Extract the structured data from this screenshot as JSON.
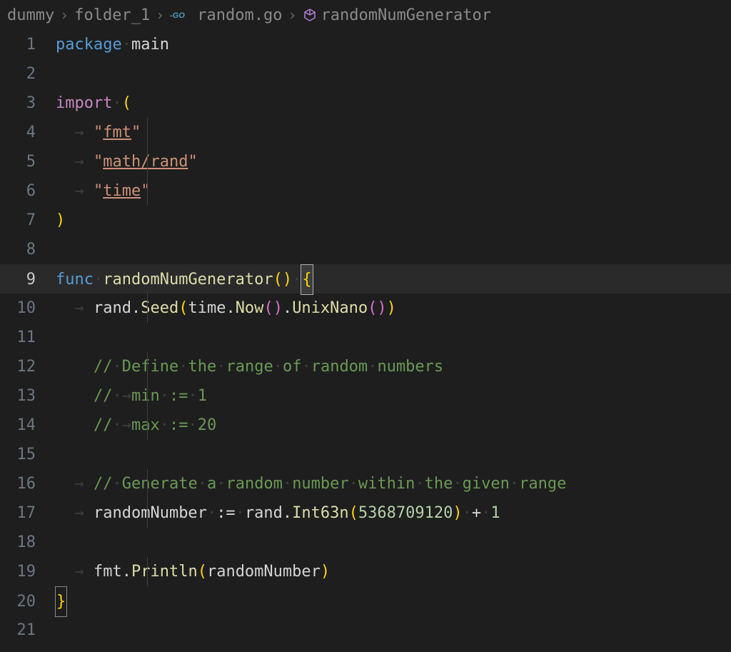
{
  "breadcrumb": {
    "items": [
      {
        "label": "dummy"
      },
      {
        "label": "folder_1"
      },
      {
        "label": "random.go",
        "icon": "go"
      },
      {
        "label": "randomNumGenerator",
        "icon": "symbol"
      }
    ]
  },
  "lines": [
    {
      "num": "1"
    },
    {
      "num": "2"
    },
    {
      "num": "3"
    },
    {
      "num": "4"
    },
    {
      "num": "5"
    },
    {
      "num": "6"
    },
    {
      "num": "7"
    },
    {
      "num": "8"
    },
    {
      "num": "9"
    },
    {
      "num": "10"
    },
    {
      "num": "11"
    },
    {
      "num": "12"
    },
    {
      "num": "13"
    },
    {
      "num": "14"
    },
    {
      "num": "15"
    },
    {
      "num": "16"
    },
    {
      "num": "17"
    },
    {
      "num": "18"
    },
    {
      "num": "19"
    },
    {
      "num": "20"
    },
    {
      "num": "21"
    }
  ],
  "code": {
    "l1": {
      "package": "package",
      "main": "main"
    },
    "l3": {
      "import": "import",
      "paren": "("
    },
    "l4": {
      "q1": "\"",
      "s": "fmt",
      "q2": "\""
    },
    "l5": {
      "q1": "\"",
      "s": "math/rand",
      "q2": "\""
    },
    "l6": {
      "q1": "\"",
      "s": "time",
      "q2": "\""
    },
    "l7": {
      "paren": ")"
    },
    "l9": {
      "func": "func",
      "name": "randomNumGenerator",
      "p1": "(",
      "p2": ")",
      "brace": "{"
    },
    "l10": {
      "rand": "rand",
      "dot1": ".",
      "seed": "Seed",
      "p1": "(",
      "time": "time",
      "dot2": ".",
      "now": "Now",
      "p2": "(",
      "p3": ")",
      "dot3": ".",
      "unix": "UnixNano",
      "p4": "(",
      "p5": ")",
      "p6": ")"
    },
    "l12": {
      "c": "// Define the range of random numbers",
      "dots": "·······"
    },
    "l13": {
      "c": "// min := 1",
      "arrow": "→",
      "dots": "···"
    },
    "l14": {
      "c": "// max := 20",
      "arrow": "→",
      "dots": "···"
    },
    "l16": {
      "c": "// Generate a random number within the given range",
      "dots": "·········"
    },
    "l17": {
      "rn": "randomNumber",
      "op": ":=",
      "rand": "rand",
      "dot": ".",
      "fn": "Int63n",
      "p1": "(",
      "num": "5368709120",
      "p2": ")",
      "plus": "+",
      "one": "1"
    },
    "l19": {
      "fmt": "fmt",
      "dot": ".",
      "fn": "Println",
      "p1": "(",
      "arg": "randomNumber",
      "p2": ")"
    },
    "l20": {
      "brace": "}"
    }
  }
}
